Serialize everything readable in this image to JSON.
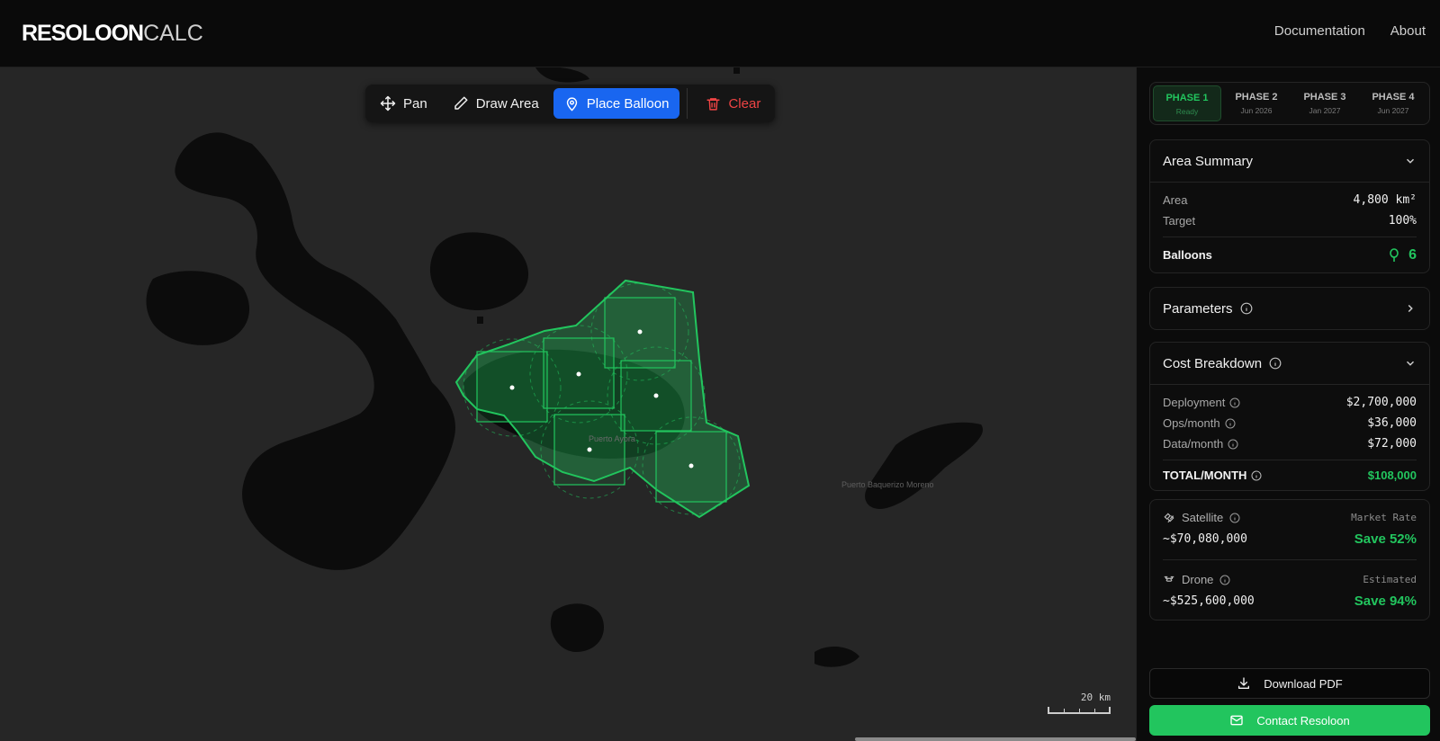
{
  "header": {
    "logo_part1": "RESOLOON",
    "logo_part2": "CALC",
    "nav": [
      "Documentation",
      "About"
    ]
  },
  "toolbar": {
    "pan": "Pan",
    "draw_area": "Draw Area",
    "place_balloon": "Place Balloon",
    "clear": "Clear",
    "active": "Place Balloon"
  },
  "map": {
    "labels": [
      "Puerto Ayora",
      "Puerto Baquerizo Moreno"
    ],
    "scale_label": "20 km",
    "colors": {
      "land": "#0c0c0c",
      "water": "#262626",
      "coverage": "#22c55e"
    }
  },
  "phases": [
    {
      "title": "PHASE 1",
      "sub": "Ready",
      "active": true
    },
    {
      "title": "PHASE 2",
      "sub": "Jun 2026",
      "active": false
    },
    {
      "title": "PHASE 3",
      "sub": "Jan 2027",
      "active": false
    },
    {
      "title": "PHASE 4",
      "sub": "Jun 2027",
      "active": false
    }
  ],
  "area_summary": {
    "title": "Area Summary",
    "area_label": "Area",
    "area_value": "4,800 km²",
    "target_label": "Target",
    "target_value": "100%",
    "balloons_label": "Balloons",
    "balloons_value": "6"
  },
  "parameters": {
    "title": "Parameters"
  },
  "cost_breakdown": {
    "title": "Cost Breakdown",
    "deployment_label": "Deployment",
    "deployment_value": "$2,700,000",
    "ops_label": "Ops/month",
    "ops_value": "$36,000",
    "data_label": "Data/month",
    "data_value": "$72,000",
    "total_label": "TOTAL/MONTH",
    "total_value": "$108,000"
  },
  "comparison": {
    "satellite_label": "Satellite",
    "satellite_tag": "Market Rate",
    "satellite_value": "~$70,080,000",
    "satellite_save": "Save 52%",
    "drone_label": "Drone",
    "drone_tag": "Estimated",
    "drone_value": "~$525,600,000",
    "drone_save": "Save 94%"
  },
  "actions": {
    "download": "Download PDF",
    "contact": "Contact Resoloon"
  }
}
